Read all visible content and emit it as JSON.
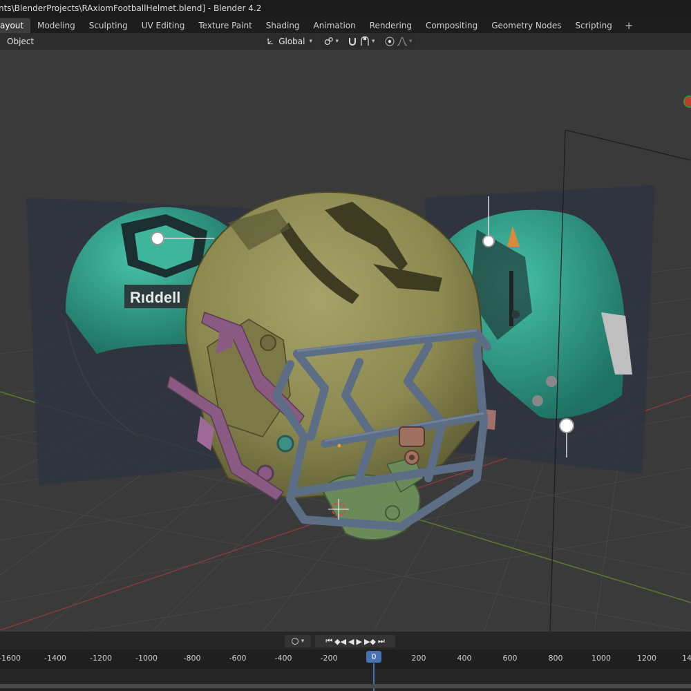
{
  "window": {
    "title": "nts\\BlenderProjects\\RAxiomFootballHelmet.blend] - Blender 4.2"
  },
  "workspace_tabs": [
    {
      "label": "ayout",
      "active": true
    },
    {
      "label": "Modeling"
    },
    {
      "label": "Sculpting"
    },
    {
      "label": "UV Editing"
    },
    {
      "label": "Texture Paint"
    },
    {
      "label": "Shading"
    },
    {
      "label": "Animation"
    },
    {
      "label": "Rendering"
    },
    {
      "label": "Compositing"
    },
    {
      "label": "Geometry Nodes"
    },
    {
      "label": "Scripting"
    }
  ],
  "add_workspace_icon": "plus-icon",
  "viewport_header": {
    "object_menu": "Object",
    "transform_orientation": "Global",
    "transform_orientation_icon": "orientation-icon",
    "pivot_icon": "pivot-icon",
    "snap_icon": "magnet-snap-icon",
    "snap_target_icon": "snap-target-icon",
    "proportional_icon": "proportional-editing-icon",
    "falloff_icon": "falloff-curve-icon"
  },
  "viewport": {
    "reference_left_brand": "Rıddell",
    "colors": {
      "background": "#3a3a3a",
      "grid": "#454545",
      "x_axis": "#8a3a3a",
      "y_axis": "#5b7a2c",
      "helmet_shell": "#8f8c52",
      "facemask": "#5b6e86",
      "clips": "#8a5a82",
      "chin_strap": "#6a8a5a",
      "reference_teal": "#2fa08a"
    }
  },
  "timeline": {
    "current_frame": "0",
    "controls": {
      "keyframe_dot_icon": "record-icon",
      "jump_start_icon": "jump-start-icon",
      "prev_keyframe_icon": "prev-keyframe-icon",
      "play_reverse_icon": "play-reverse-icon",
      "play_icon": "play-icon",
      "next_keyframe_icon": "next-keyframe-icon",
      "jump_end_icon": "jump-end-icon"
    },
    "ticks": [
      "-1600",
      "-1400",
      "-1200",
      "-1000",
      "-800",
      "-600",
      "-400",
      "-200",
      "200",
      "400",
      "600",
      "800",
      "1000",
      "1200",
      "14"
    ]
  }
}
